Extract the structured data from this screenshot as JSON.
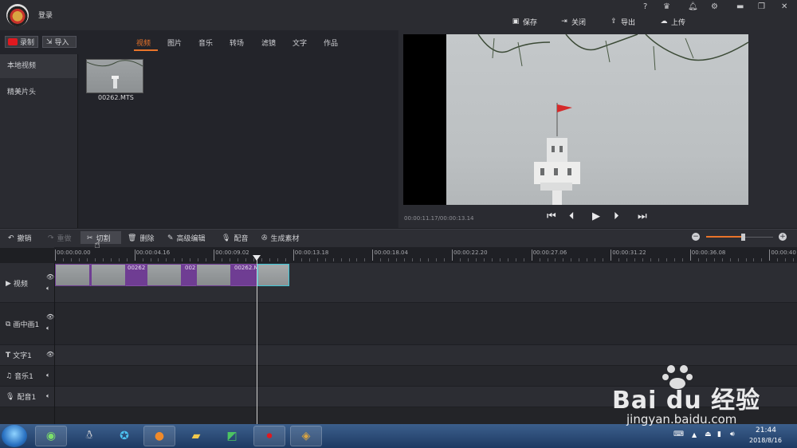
{
  "titlebar": {
    "login_label": "登录",
    "help_icon": "?",
    "actions": [
      {
        "label": "保存",
        "icon": "save-icon"
      },
      {
        "label": "关闭",
        "icon": "close-project-icon"
      },
      {
        "label": "导出",
        "icon": "export-icon"
      },
      {
        "label": "上传",
        "icon": "upload-icon"
      }
    ]
  },
  "media": {
    "record_label": "录制",
    "import_label": "导入",
    "tabs": [
      "视频",
      "图片",
      "音乐",
      "转场",
      "滤镜",
      "文字",
      "作品"
    ],
    "active_tab": "视频",
    "categories": [
      "本地视频",
      "精美片头"
    ],
    "files": [
      {
        "name": "00262.MTS"
      }
    ]
  },
  "preview": {
    "time": "00:00:11.17/00:00:13.14"
  },
  "toolbar": {
    "undo": "撤销",
    "redo": "重做",
    "cut": "切割",
    "delete": "删除",
    "advanced_edit": "高级编辑",
    "dub": "配音",
    "generate": "生成素材",
    "zoom_level": 0.55
  },
  "timeline": {
    "ruler_ticks": [
      "00:00:00.00",
      "00:00:04.16",
      "00:00:09.02",
      "00:00:13.18",
      "00:00:18.04",
      "00:00:22.20",
      "00:00:27.06",
      "00:00:31.22",
      "00:00:36.08",
      "00:00:40"
    ],
    "tracks": [
      {
        "label": "视频"
      },
      {
        "label": "画中画1"
      },
      {
        "label": "文字1"
      },
      {
        "label": "音乐1"
      },
      {
        "label": "配音1"
      }
    ],
    "clip_labels": [
      "00262",
      "002",
      "00262.M"
    ]
  },
  "taskbar": {
    "time": "21:44",
    "date": "2018/8/16"
  },
  "watermark": {
    "brand": "Bai du 经验",
    "url": "jingyan.baidu.com"
  },
  "colors": {
    "accent": "#e9742a",
    "clip_purple": "#6f3d93",
    "record_red": "#e0191f"
  }
}
